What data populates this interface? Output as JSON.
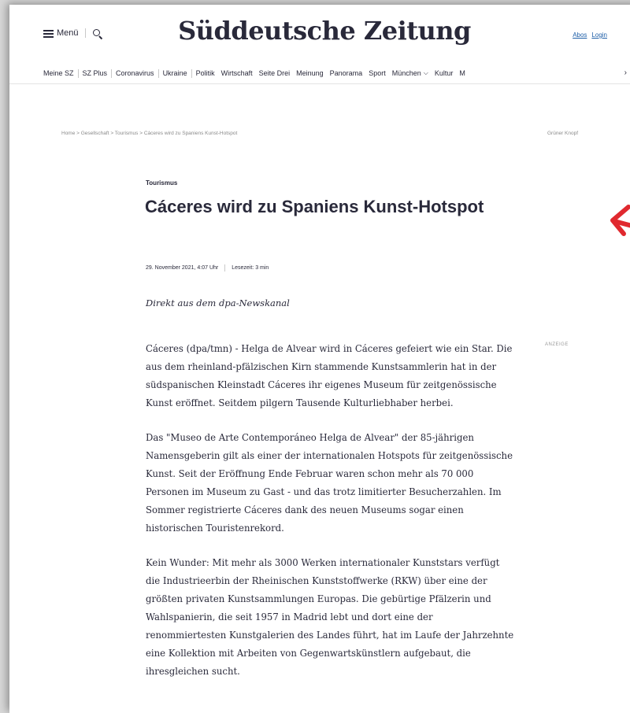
{
  "header": {
    "menu_label": "Menü",
    "logo": "Süddeutsche Zeitung",
    "abos": "Abos",
    "login": "Login"
  },
  "nav": {
    "items": [
      "Meine SZ",
      "SZ Plus",
      "Coronavirus",
      "Ukraine",
      "Politik",
      "Wirtschaft",
      "Seite Drei",
      "Meinung",
      "Panorama",
      "Sport",
      "München",
      "Kultur",
      "M"
    ]
  },
  "breadcrumb": {
    "path": "Home > Gesellschaft > Tourismus > Cáceres wird zu Spaniens Kunst-Hotspot",
    "right": "Grüner Knopf"
  },
  "article": {
    "kicker": "Tourismus",
    "headline": "Cáceres wird zu Spaniens Kunst-Hotspot",
    "date": "29. November 2021, 4:07 Uhr",
    "reading_time": "Lesezeit: 3 min",
    "teaser": "Direkt aus dem dpa-Newskanal",
    "ad_label": "ANZEIGE",
    "paragraphs": [
      "Cáceres (dpa/tmn) - Helga de Alvear wird in Cáceres gefeiert wie ein Star. Die aus dem rheinland-pfälzischen Kirn stammende Kunstsammlerin hat in der südspanischen Kleinstadt Cáceres ihr eigenes Museum für zeitgenössische Kunst eröffnet. Seitdem pilgern Tausende Kulturliebhaber herbei.",
      "Das \"Museo de Arte Contemporáneo Helga de Alvear\" der 85-jährigen Namensgeberin gilt als einer der internationalen Hotspots für zeitgenössische Kunst. Seit der Eröffnung Ende Februar waren schon mehr als 70 000 Personen im Museum zu Gast - und das trotz limitierter Besucherzahlen. Im Sommer registrierte Cáceres dank des neuen Museums sogar einen historischen Touristenrekord.",
      "Kein Wunder: Mit mehr als 3000 Werken internationaler Kunststars verfügt die Industrieerbin der Rheinischen Kunststoffwerke (RKW) über eine der größten privaten Kunstsammlungen Europas. Die gebürtige Pfälzerin und Wahlspanierin, die seit 1957 in Madrid lebt und dort eine der renommiertesten Kunstgalerien des Landes führt, hat im Laufe der Jahrzehnte eine Kollektion mit Arbeiten von Gegenwartskünstlern aufgebaut, die ihresgleichen sucht."
    ]
  },
  "colors": {
    "text": "#29293a",
    "link": "#1f5fa8",
    "annotation_arrow": "#e0292f"
  }
}
